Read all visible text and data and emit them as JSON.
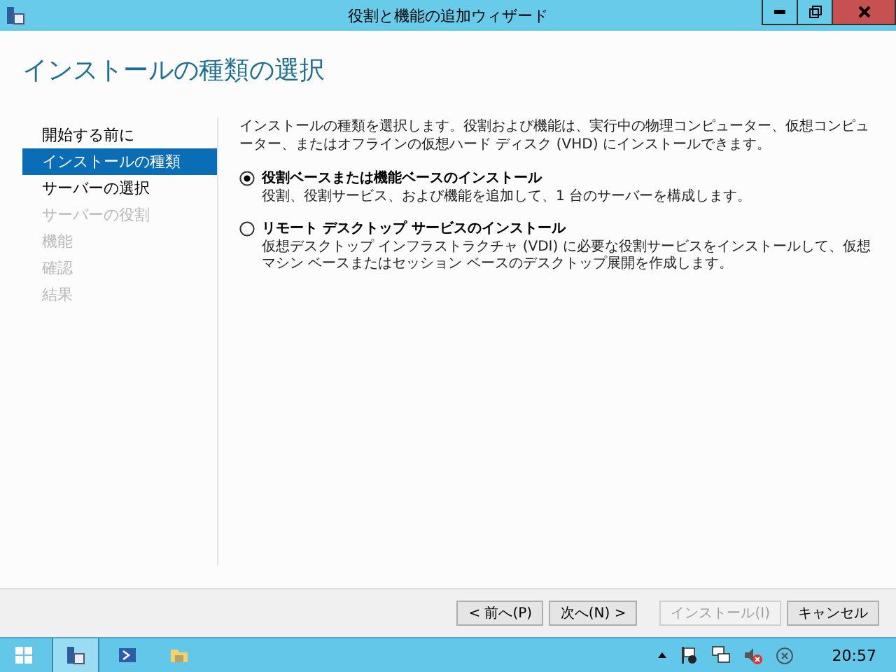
{
  "window": {
    "title": "役割と機能の追加ウィザード"
  },
  "page_title": "インストールの種類の選択",
  "nav": [
    {
      "label": "開始する前に",
      "selected": false,
      "disabled": false
    },
    {
      "label": "インストールの種類",
      "selected": true,
      "disabled": false
    },
    {
      "label": "サーバーの選択",
      "selected": false,
      "disabled": false
    },
    {
      "label": "サーバーの役割",
      "selected": false,
      "disabled": true
    },
    {
      "label": "機能",
      "selected": false,
      "disabled": true
    },
    {
      "label": "確認",
      "selected": false,
      "disabled": true
    },
    {
      "label": "結果",
      "selected": false,
      "disabled": true
    }
  ],
  "intro": "インストールの種類を選択します。役割および機能は、実行中の物理コンピューター、仮想コンピューター、またはオフラインの仮想ハード ディスク (VHD) にインストールできます。",
  "options": [
    {
      "label": "役割ベースまたは機能ベースのインストール",
      "description": "役割、役割サービス、および機能を追加して、1 台のサーバーを構成します。",
      "selected": true
    },
    {
      "label": "リモート デスクトップ サービスのインストール",
      "description": "仮想デスクトップ インフラストラクチャ (VDI) に必要な役割サービスをインストールして、仮想マシン ベースまたはセッション ベースのデスクトップ展開を作成します。",
      "selected": false
    }
  ],
  "buttons": [
    {
      "label": "< 前へ(P)",
      "disabled": false
    },
    {
      "label": "次へ(N) >",
      "disabled": false
    },
    {
      "label": "インストール(I)",
      "disabled": true
    },
    {
      "label": "キャンセル",
      "disabled": false
    }
  ],
  "taskbar": {
    "clock": "20:57"
  }
}
